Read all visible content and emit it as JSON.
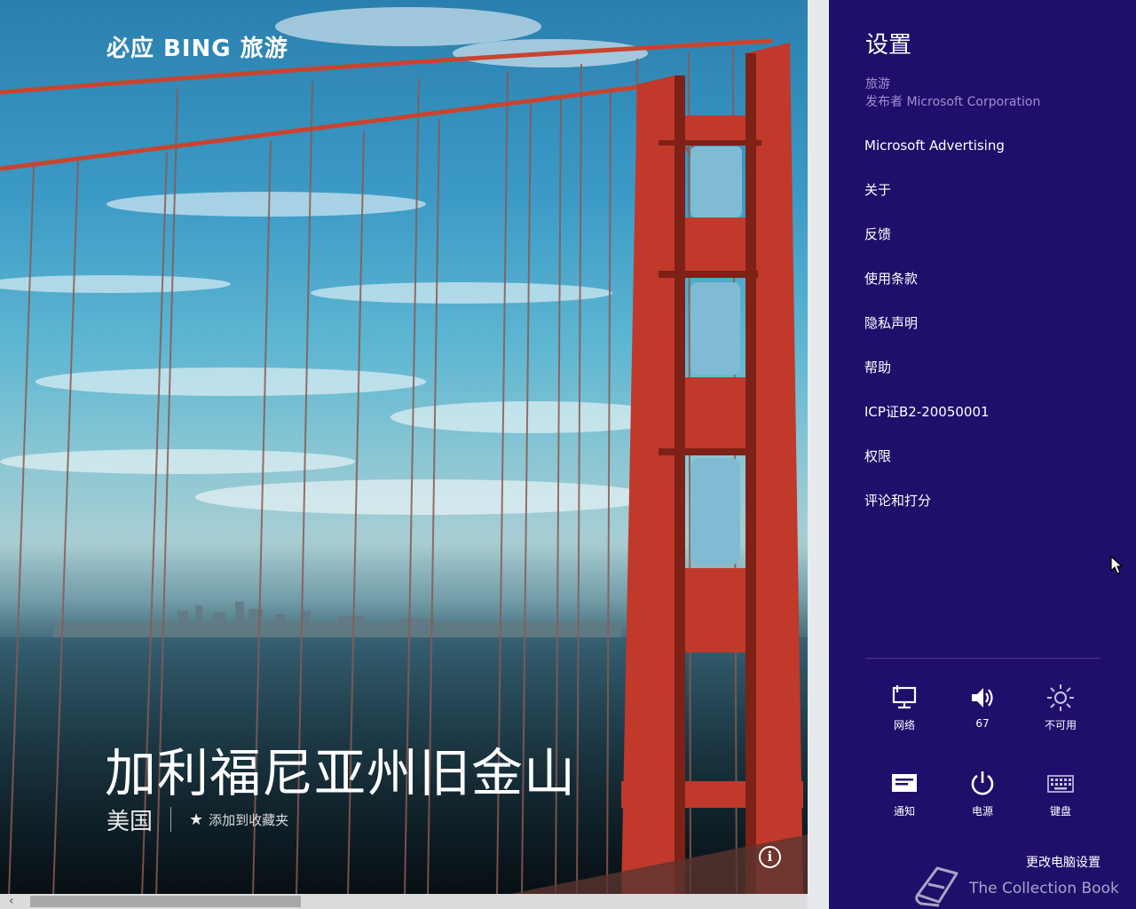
{
  "app": {
    "title": "必应 BING 旅游",
    "destination": {
      "title": "加利福尼亚州旧金山",
      "country": "美国",
      "favorite_label": "添加到收藏夹"
    },
    "info_icon": "info-icon",
    "scroll_left": "‹"
  },
  "settings": {
    "title": "设置",
    "app_name": "旅游",
    "publisher": "发布者 Microsoft Corporation",
    "items": [
      {
        "label": "Microsoft Advertising"
      },
      {
        "label": "关于"
      },
      {
        "label": "反馈"
      },
      {
        "label": "使用条款"
      },
      {
        "label": "隐私声明"
      },
      {
        "label": "帮助"
      },
      {
        "label": "ICP证B2-20050001"
      },
      {
        "label": "权限"
      },
      {
        "label": "评论和打分"
      }
    ],
    "system_tiles": [
      {
        "icon": "network-icon",
        "label": "网络"
      },
      {
        "icon": "volume-icon",
        "label": "67"
      },
      {
        "icon": "brightness-icon",
        "label": "不可用"
      },
      {
        "icon": "notifications-icon",
        "label": "通知"
      },
      {
        "icon": "power-icon",
        "label": "电源"
      },
      {
        "icon": "keyboard-icon",
        "label": "键盘"
      }
    ],
    "change_pc_settings": "更改电脑设置"
  },
  "watermark": {
    "text": "The Collection Book",
    "icon": "book-icon"
  },
  "colors": {
    "panel_bg": "#200e6b",
    "panel_secondary_text": "#9f90cf",
    "bridge_red": "#c0392b"
  }
}
